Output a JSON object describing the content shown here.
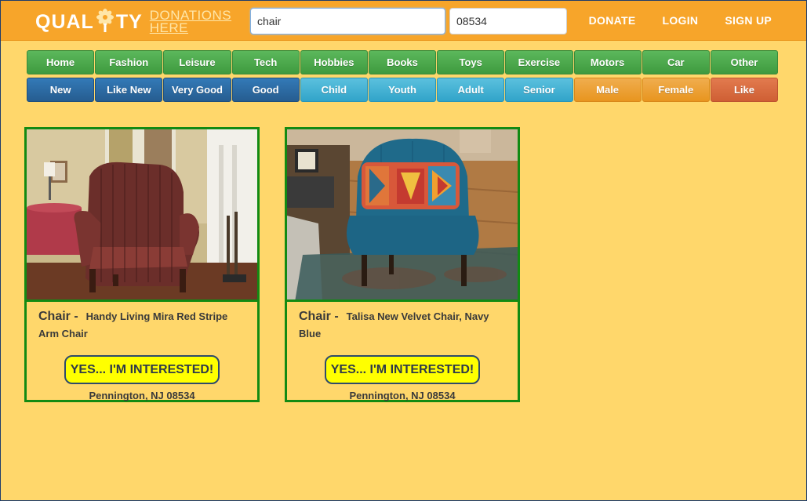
{
  "header": {
    "logo_left": "QUAL",
    "logo_right": "TY",
    "logo_sub_1": "DONATIONS",
    "logo_sub_2": "HERE",
    "search_value": "chair",
    "zip_value": "08534",
    "links": {
      "donate": "DONATE",
      "login": "LOGIN",
      "signup": "SIGN UP"
    }
  },
  "categories": [
    "Home",
    "Fashion",
    "Leisure",
    "Tech",
    "Hobbies",
    "Books",
    "Toys",
    "Exercise",
    "Motors",
    "Car",
    "Other"
  ],
  "filters": {
    "condition": [
      "New",
      "Like New",
      "Very Good",
      "Good"
    ],
    "age": [
      "Child",
      "Youth",
      "Adult",
      "Senior"
    ],
    "gender": [
      "Male",
      "Female"
    ],
    "like": "Like"
  },
  "colors": {
    "header": "#f7a52a",
    "background": "#ffd76b",
    "card_border": "#138a13",
    "interest_button": "#ffff00"
  },
  "listings": [
    {
      "category": "Chair -",
      "title": "Handy Living Mira Red Stripe Arm Chair",
      "button": "YES... I'M INTERESTED!",
      "location": "Pennington, NJ 08534",
      "image": "red-stripe-armchair-photo"
    },
    {
      "category": "Chair -",
      "title": "Talisa New Velvet Chair, Navy Blue",
      "button": "YES... I'M INTERESTED!",
      "location": "Pennington, NJ 08534",
      "image": "navy-velvet-chair-photo"
    }
  ]
}
